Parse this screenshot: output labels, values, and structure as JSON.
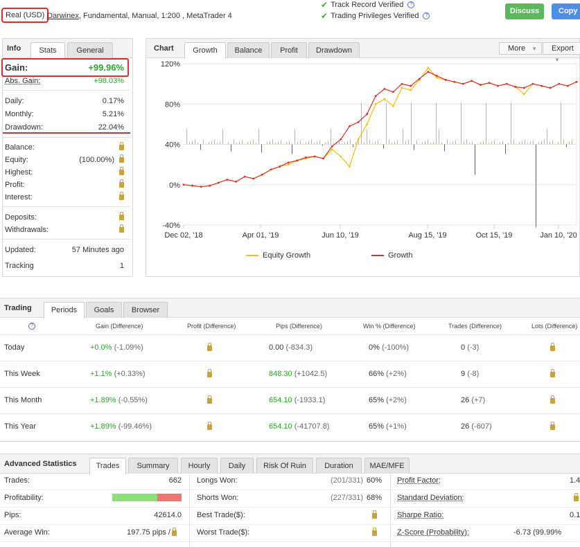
{
  "header": {
    "account_type": "Real (USD)",
    "broker": "Darwinex",
    "details": ", Fundamental, Manual, 1:200 , MetaTrader 4",
    "track_record": "Track Record Verified",
    "trading_privileges": "Trading Privileges Verified",
    "discuss_label": "Discuss",
    "copy_label": "Copy"
  },
  "info": {
    "title": "Info",
    "tabs": [
      "Stats",
      "General"
    ],
    "gain_label": "Gain:",
    "gain_value": "+99.96%",
    "abs_gain_label": "Abs. Gain:",
    "abs_gain_value": "+98.03%",
    "daily_label": "Daily:",
    "daily_value": "0.17%",
    "monthly_label": "Monthly:",
    "monthly_value": "5.21%",
    "drawdown_label": "Drawdown:",
    "drawdown_value": "22.04%",
    "balance_label": "Balance:",
    "equity_label": "Equity:",
    "equity_value": "(100.00%)",
    "highest_label": "Highest:",
    "profit_label": "Profit:",
    "interest_label": "Interest:",
    "deposits_label": "Deposits:",
    "withdrawals_label": "Withdrawals:",
    "updated_label": "Updated:",
    "updated_value": "57 Minutes ago",
    "tracking_label": "Tracking",
    "tracking_value": "1"
  },
  "chart": {
    "title": "Chart",
    "tabs": [
      "Growth",
      "Balance",
      "Profit",
      "Drawdown"
    ],
    "more_label": "More",
    "export_label": "Export",
    "legend": [
      "Equity Growth",
      "Growth"
    ]
  },
  "chart_data": {
    "type": "line",
    "y_tick_labels": [
      "120%",
      "80%",
      "40%",
      "0%",
      "-40%"
    ],
    "x_tick_labels": [
      "Dec 02, '18",
      "Apr 01, '19",
      "Jun 10, '19",
      "Aug 15, '19",
      "Oct 15, '19",
      "Jan 10, '20"
    ],
    "ylim": [
      -40,
      120
    ],
    "series": [
      {
        "name": "Growth",
        "color": "#d9302f",
        "values": [
          0,
          -1,
          -2,
          -1,
          2,
          5,
          3,
          8,
          6,
          10,
          15,
          18,
          22,
          24,
          27,
          28,
          26,
          38,
          45,
          58,
          62,
          70,
          88,
          95,
          92,
          100,
          98,
          105,
          112,
          108,
          104,
          102,
          100,
          103,
          99,
          101,
          98,
          100,
          97,
          96,
          100,
          98,
          96,
          100,
          98,
          102
        ]
      },
      {
        "name": "Equity Growth",
        "color": "#f2c200",
        "values": [
          0,
          -1,
          -2,
          -1,
          2,
          5,
          3,
          8,
          6,
          10,
          15,
          18,
          20,
          24,
          26,
          28,
          26,
          35,
          28,
          18,
          45,
          60,
          80,
          85,
          78,
          96,
          94,
          104,
          116,
          106,
          104,
          102,
          100,
          103,
          99,
          101,
          98,
          100,
          97,
          90,
          100,
          98,
          96,
          100,
          98,
          102
        ]
      }
    ]
  },
  "trading": {
    "title": "Trading",
    "tabs": [
      "Periods",
      "Goals",
      "Browser"
    ],
    "columns": [
      "Gain (Difference)",
      "Profit (Difference)",
      "Pips (Difference)",
      "Win % (Difference)",
      "Trades (Difference)",
      "Lots (Difference)"
    ],
    "rows": [
      {
        "period": "Today",
        "gain": "+0.0%",
        "gain_diff": "(-1.09%)",
        "pips": "0.00",
        "pips_diff": "(-834.3)",
        "pips_green": false,
        "win": "0%",
        "win_diff": "(-100%)",
        "trades": "0",
        "trades_diff": "(-3)"
      },
      {
        "period": "This Week",
        "gain": "+1.1%",
        "gain_diff": "(+0.33%)",
        "pips": "848.30",
        "pips_diff": "(+1042.5)",
        "pips_green": true,
        "win": "66%",
        "win_diff": "(+2%)",
        "trades": "9",
        "trades_diff": "(-8)"
      },
      {
        "period": "This Month",
        "gain": "+1.89%",
        "gain_diff": "(-0.55%)",
        "pips": "654.10",
        "pips_diff": "(-1933.1)",
        "pips_green": true,
        "win": "65%",
        "win_diff": "(+2%)",
        "trades": "26",
        "trades_diff": "(+7)"
      },
      {
        "period": "This Year",
        "gain": "+1.89%",
        "gain_diff": "(-99.46%)",
        "pips": "654.10",
        "pips_diff": "(-41707.8)",
        "pips_green": true,
        "win": "65%",
        "win_diff": "(+1%)",
        "trades": "26",
        "trades_diff": "(-607)"
      }
    ]
  },
  "advanced": {
    "title": "Advanced Statistics",
    "tabs": [
      "Trades",
      "Summary",
      "Hourly",
      "Daily",
      "Risk Of Ruin",
      "Duration",
      "MAE/MFE"
    ],
    "trades_label": "Trades:",
    "trades_value": "662",
    "profitability_label": "Profitability:",
    "profitability_win_fraction": 0.65,
    "pips_label": "Pips:",
    "pips_value": "42614.0",
    "avg_win_label": "Average Win:",
    "avg_win_value": "197.75 pips /",
    "longs_won_label": "Longs Won:",
    "longs_won_frac": "(201/331)",
    "longs_won_pct": "60%",
    "shorts_won_label": "Shorts Won:",
    "shorts_won_frac": "(227/331)",
    "shorts_won_pct": "68%",
    "best_trade_label": "Best Trade($):",
    "worst_trade_label": "Worst Trade($):",
    "profit_factor_label": "Profit Factor:",
    "profit_factor_value": "1.4",
    "std_dev_label": "Standard Deviation:",
    "sharpe_label": "Sharpe Ratio:",
    "sharpe_value": "0.1",
    "zscore_label": "Z-Score (Probability):",
    "zscore_value": "-6.73 (99.99%"
  }
}
